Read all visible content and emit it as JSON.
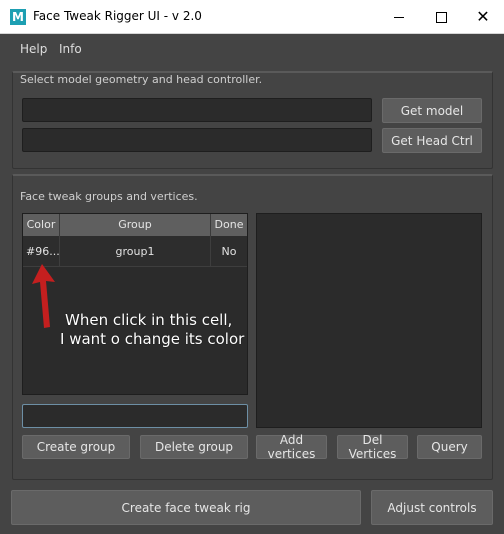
{
  "window": {
    "title": "Face Tweak Rigger UI - v 2.0",
    "app_icon": "M",
    "controls": {
      "minimize": "minimize-icon",
      "maximize": "maximize-icon",
      "close": "✕"
    }
  },
  "menu": {
    "help": "Help",
    "info": "Info"
  },
  "model_section": {
    "label": "Select model geometry and head controller.",
    "model_field_value": "",
    "head_field_value": "",
    "get_model_label": "Get model",
    "get_head_label": "Get Head Ctrl"
  },
  "groups_section": {
    "label": "Face tweak groups and vertices.",
    "table": {
      "headers": [
        "Color",
        "Group",
        "Done"
      ],
      "rows": [
        {
          "color": "#96...",
          "group": "group1",
          "done": "No"
        }
      ]
    },
    "group_name_value": "",
    "create_group_label": "Create group",
    "delete_group_label": "Delete group",
    "add_vertices_label": "Add vertices",
    "del_vertices_label": "Del Vertices",
    "query_label": "Query"
  },
  "footer": {
    "create_rig_label": "Create face tweak rig",
    "adjust_label": "Adjust controls"
  },
  "annotation": {
    "line1": "When click in this cell,",
    "line2": "I want o change its color",
    "arrow_color": "#c41f1f"
  }
}
